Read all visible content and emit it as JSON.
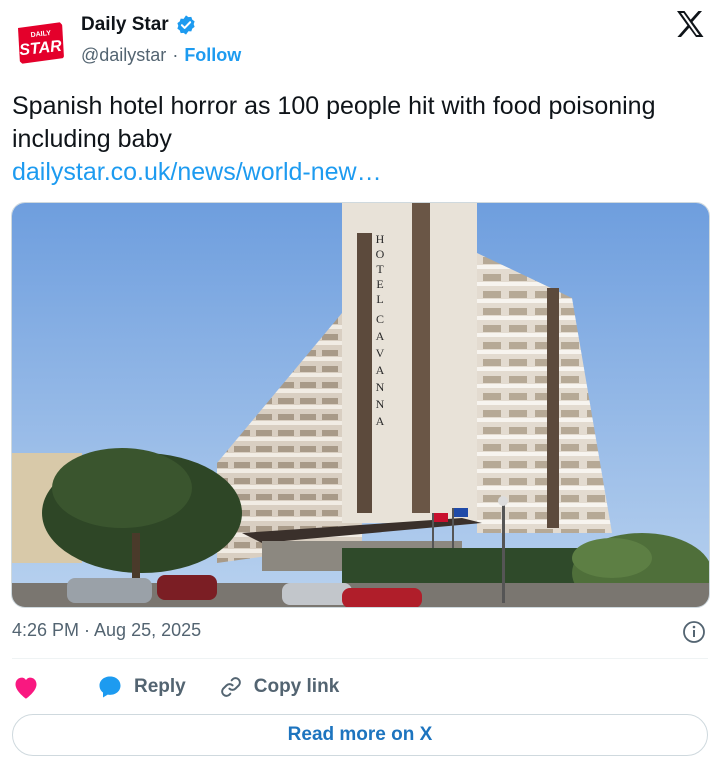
{
  "account": {
    "display_name": "Daily Star",
    "handle": "@dailystar",
    "separator": "·",
    "follow_label": "Follow",
    "logo_top": "DAILY",
    "logo_main": "STAR"
  },
  "tweet": {
    "text": "Spanish hotel horror as 100 people hit with food poisoning including baby",
    "link": "dailystar.co.uk/news/world-new…",
    "timestamp": "4:26 PM · Aug 25, 2025"
  },
  "photo": {
    "sign_letters": [
      "H",
      "O",
      "T",
      "E",
      "L",
      "",
      "C",
      "A",
      "V",
      "A",
      "N",
      "N",
      "A"
    ]
  },
  "actions": {
    "reply_label": "Reply",
    "copy_link_label": "Copy link",
    "read_more_label": "Read more on X"
  },
  "colors": {
    "accent": "#1d9bf0",
    "heart": "#f91880",
    "brand_red": "#e4002b"
  }
}
